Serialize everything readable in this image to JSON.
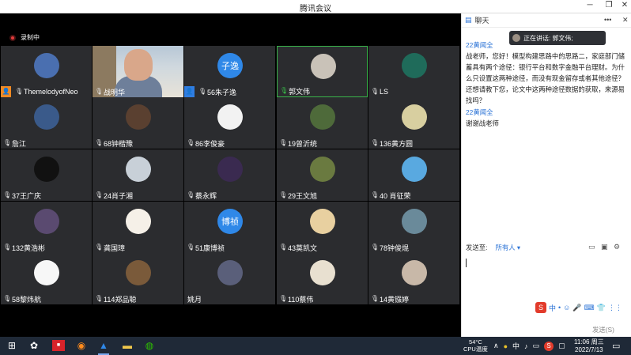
{
  "window": {
    "title": "腾讯会议",
    "minimize": "─",
    "restore": "❐",
    "close": "✕"
  },
  "recording": {
    "label": "录制中"
  },
  "participants": [
    {
      "name": "ThemelodyofNeo",
      "role": "host",
      "avatar_color": "#4a6fb0"
    },
    {
      "name": "战明华",
      "video": true
    },
    {
      "name": "56朱子逸",
      "role": "cohost",
      "avatar_text": "子逸",
      "avatar_color": "#2f88e8"
    },
    {
      "name": "郭文伟",
      "mic_on": true,
      "avatar_color": "#c9c2b8"
    },
    {
      "name": "LS",
      "avatar_color": "#1f6b5a"
    },
    {
      "name": "詹江",
      "avatar_color": "#3a5a8a"
    },
    {
      "name": "68钟楷豫",
      "avatar_color": "#5a4030"
    },
    {
      "name": "86李俊豪",
      "avatar_color": "#f2f2f2"
    },
    {
      "name": "19曾沂统",
      "avatar_color": "#4e6a3a"
    },
    {
      "name": "136黄方圆",
      "avatar_color": "#d8cfa0"
    },
    {
      "name": "37王广庆",
      "avatar_color": "#111111"
    },
    {
      "name": "24肖子湘",
      "avatar_color": "#c8d0d8"
    },
    {
      "name": "蔡永辉",
      "avatar_color": "#3a2a50"
    },
    {
      "name": "29王文旭",
      "avatar_color": "#6a7a40"
    },
    {
      "name": "40   肖征荣",
      "avatar_color": "#59a9e0"
    },
    {
      "name": "132黄浩彬",
      "avatar_color": "#5a4a70"
    },
    {
      "name": "龚国璋",
      "avatar_color": "#f5f0e8"
    },
    {
      "name": "51康博祯",
      "avatar_text": "博祯",
      "avatar_color": "#2f88e8"
    },
    {
      "name": "43莫凯文",
      "avatar_color": "#e8d0a0"
    },
    {
      "name": "78钟俊焜",
      "avatar_color": "#6a8a9a"
    },
    {
      "name": "58黎炜航",
      "avatar_color": "#f7f7f7"
    },
    {
      "name": "114郑品聪",
      "avatar_color": "#7a5a3a"
    },
    {
      "name": "姚月",
      "no_mic": true,
      "avatar_color": "#5a5f7a"
    },
    {
      "name": "110蔡伟",
      "avatar_color": "#e8e0d0"
    },
    {
      "name": "14黄镪婷",
      "avatar_color": "#c8b8a8"
    }
  ],
  "chat": {
    "title": "聊天",
    "speaking_label": "正在讲话: 郭文伟;",
    "messages": [
      {
        "sender": "22黄闻全",
        "text": "战老师，您好！模型构建思路中的思路二，家庭部门储蓄具有两个途径：银行平台和数字金融平台理财。为什么只设置这两种途径，而没有现金留存或者其他途径？还想请教下您，论文中这两种途径数据的获取，来源易找吗？"
      },
      {
        "sender": "22黄闻全",
        "text": "谢谢战老师"
      }
    ],
    "send_to_label": "发送至:",
    "send_to_target": "所有人 ▾",
    "send_button": "发送(S)"
  },
  "ime": {
    "items": [
      "中",
      "•",
      "☺",
      "🎤",
      "⌨",
      "👕",
      "⋮⋮"
    ]
  },
  "taskbar": {
    "temperature": "54°C",
    "temperature_label": "CPU温度",
    "time": "11:06 周三",
    "date": "2022/7/13",
    "lang": "中"
  }
}
